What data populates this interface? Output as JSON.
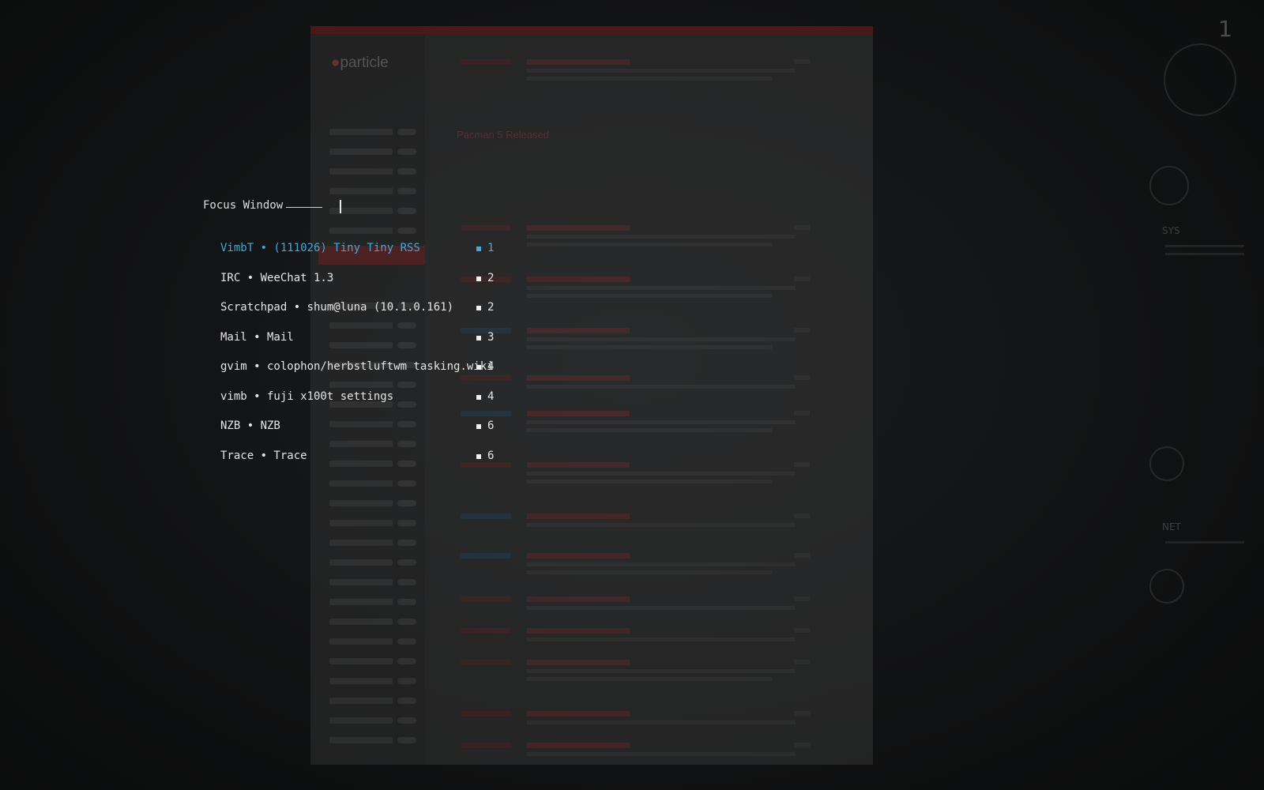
{
  "focus_window": {
    "title": "Focus Window",
    "windows": [
      {
        "label": "VimbT • (111026) Tiny Tiny RSS",
        "tag": "1",
        "active": true
      },
      {
        "label": "IRC • WeeChat 1.3",
        "tag": "2",
        "active": false
      },
      {
        "label": "Scratchpad • shum@luna (10.1.0.161)",
        "tag": "2",
        "active": false
      },
      {
        "label": "Mail • Mail",
        "tag": "3",
        "active": false
      },
      {
        "label": "gvim • colophon/herbstluftwm tasking.wiki",
        "tag": "4",
        "active": false
      },
      {
        "label": "vimb • fuji x100t settings",
        "tag": "4",
        "active": false
      },
      {
        "label": "NZB • NZB",
        "tag": "6",
        "active": false
      },
      {
        "label": "Trace • Trace",
        "tag": "6",
        "active": false
      }
    ]
  },
  "background": {
    "app_logo": "particle",
    "article_title": "Pacman 5 Released",
    "workspace_number": "1",
    "conky_labels": [
      "SYS",
      "NET"
    ]
  },
  "colors": {
    "active": "#45a6d8",
    "text": "#e6e6e6",
    "background": "#121314"
  }
}
